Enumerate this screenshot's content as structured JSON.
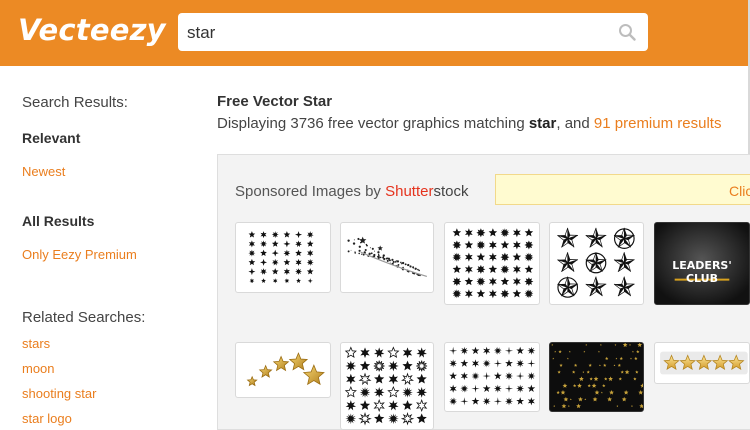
{
  "header": {
    "logo": "Vecteezy",
    "search": {
      "value": "star"
    }
  },
  "sidebar": {
    "search_results_heading": "Search Results:",
    "relevant": "Relevant",
    "newest": "Newest",
    "all_results": "All Results",
    "only_premium": "Only Eezy Premium",
    "related_heading": "Related Searches:",
    "related": [
      "stars",
      "moon",
      "shooting star",
      "star logo"
    ]
  },
  "main": {
    "title": "Free Vector Star",
    "subtitle": {
      "prefix": "Displaying 3736 free vector graphics matching ",
      "query": "star",
      "middle": ", and ",
      "premium_link": "91 premium results"
    }
  },
  "sponsored": {
    "label": "Sponsored Images by ",
    "brand_part1": "Shutter",
    "brand_part2": "stock",
    "click_text": "Click",
    "thumbnails": [
      "star-shapes-grid-thumbnail",
      "shooting-star-sparkle-thumbnail",
      "black-star-icons-thumbnail",
      "nautical-stars-thumbnail",
      "leaders-club-thumbnail",
      "gold-stars-arc-thumbnail",
      "ornate-star-collection-thumbnail",
      "sparkle-star-set-thumbnail",
      "gold-star-pattern-thumbnail",
      "rating-stars-thumbnail"
    ],
    "leaders_club_text": [
      "LEADERS'",
      "CLUB"
    ]
  },
  "colors": {
    "brand_orange": "#ec8a24",
    "link_orange": "#ea7e1e",
    "shutterstock_red": "#e5331d"
  }
}
